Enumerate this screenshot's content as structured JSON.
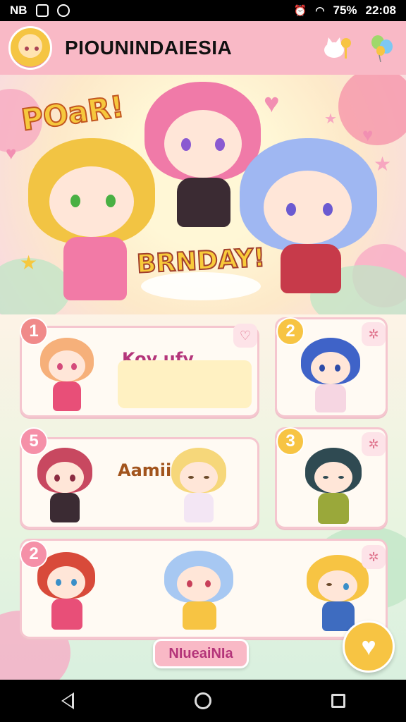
{
  "status_bar": {
    "left_label": "NB",
    "battery": "75%",
    "time": "22:08"
  },
  "header": {
    "title": "PIOUNINDAIESIA",
    "add_icon": "cat-add-icon",
    "balloon_icon": "balloons-icon"
  },
  "hero": {
    "title": "POaR!",
    "subtitle": "BRNDAY!"
  },
  "cards": [
    {
      "number": "1",
      "title": "Kov ufy",
      "badge_color": "#f08a8a",
      "corner_icon": "heart-icon"
    },
    {
      "number": "2",
      "title": "",
      "badge_color": "#f7c443",
      "corner_icon": "sparkle-icon"
    },
    {
      "number": "5",
      "title": "Aamiilo",
      "badge_color": "#f590a8",
      "corner_icon": "none"
    },
    {
      "number": "3",
      "title": "",
      "badge_color": "#f7c443",
      "corner_icon": "sparkle-icon"
    },
    {
      "number": "2",
      "title": "",
      "badge_color": "#f590a8",
      "corner_icon": "sparkle-icon"
    }
  ],
  "bottom": {
    "pill_label": "NIueaiNIa",
    "fab_icon": "heart-favorite-icon"
  },
  "colors": {
    "header": "#f9b9c6",
    "accent_pink": "#b4357a",
    "accent_yellow": "#f7c443"
  }
}
